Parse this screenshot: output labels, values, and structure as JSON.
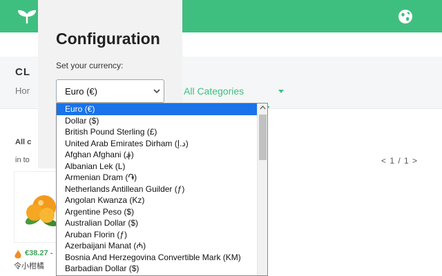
{
  "app": {
    "breadcrumb_title": "CL",
    "home_label": "Hor",
    "categories_label": "All Categories",
    "all_categories_label": "All c",
    "in_total_label": "in to",
    "pager": "< 1 / 1 >",
    "product_price": "€38.27 -",
    "product_name": "令小柑橘"
  },
  "config": {
    "title": "Configuration",
    "currency_label": "Set your currency:",
    "selected_value": "Euro (€)",
    "options": [
      "Euro (€)",
      "Dollar ($)",
      "British Pound Sterling (£)",
      "United Arab Emirates Dirham (د.إ)",
      "Afghan Afghani (؋)",
      "Albanian Lek (L)",
      "Armenian Dram (֏)",
      "Netherlands Antillean Guilder (ƒ)",
      "Angolan Kwanza (Kz)",
      "Argentine Peso ($)",
      "Australian Dollar ($)",
      "Aruban Florin (ƒ)",
      "Azerbaijani Manat (₼)",
      "Bosnia And Herzegovina Convertible Mark (KM)",
      "Barbadian Dollar ($)"
    ],
    "selected_index": 0
  },
  "colors": {
    "brand_green": "#3fbf7f",
    "selection_blue": "#1a73e8"
  },
  "icons": {
    "logo": "logo-icon",
    "language": "globe-icon",
    "chevron": "chevron-down-icon",
    "scroll_up": "scroll-up-arrow-icon"
  }
}
